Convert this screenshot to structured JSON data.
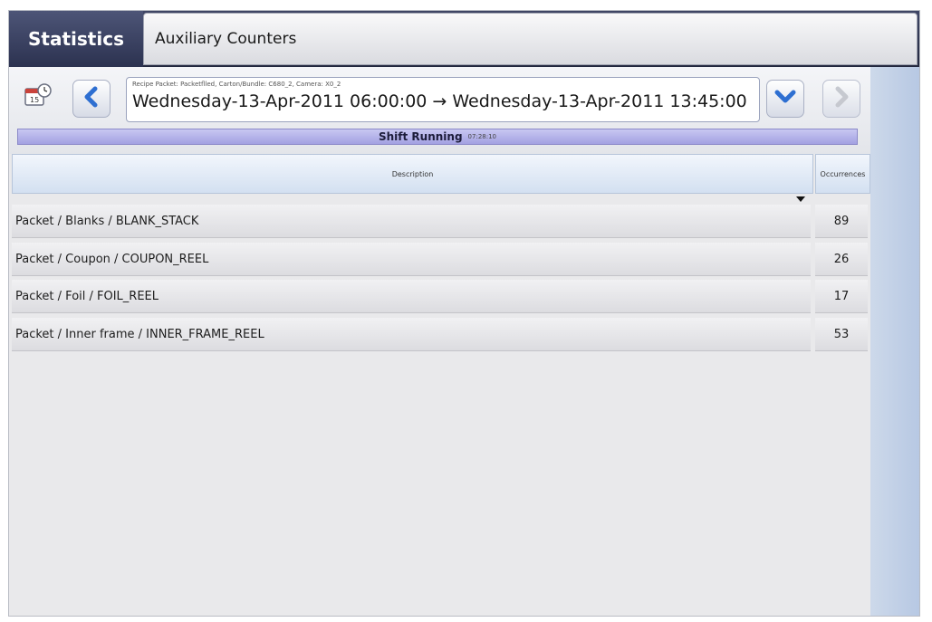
{
  "tabs": {
    "active": "Statistics",
    "secondary": "Auxiliary Counters"
  },
  "toolbar": {
    "recipe_line": "Recipe  Packet: Packetflled, Carton/Bundle: C680_2, Camera: X0_2",
    "date_range": "Wednesday-13-Apr-2011 06:00:00 → Wednesday-13-Apr-2011 13:45:00",
    "shift_label": "Shift Running",
    "shift_time": "07:28:10"
  },
  "table": {
    "columns": [
      "Description",
      "Occurrences"
    ],
    "rows": [
      {
        "description": "Packet / Blanks / BLANK_STACK",
        "occurrences": "89"
      },
      {
        "description": "Packet / Coupon / COUPON_REEL",
        "occurrences": "26"
      },
      {
        "description": "Packet / Foil / FOIL_REEL",
        "occurrences": "17"
      },
      {
        "description": "Packet / Inner frame / INNER_FRAME_REEL",
        "occurrences": "53"
      }
    ]
  },
  "icons": {
    "calendar": "calendar-clock-icon",
    "prev": "chevron-left-icon",
    "next": "chevron-right-icon",
    "dropdown": "chevron-down-icon",
    "sort": "sort-descending-icon"
  },
  "colors": {
    "titlebar": "#2c3250",
    "nav_arrow": "#2e6fd1",
    "shift_bar": "#b3b1e8",
    "header": "#d3e0f1"
  }
}
